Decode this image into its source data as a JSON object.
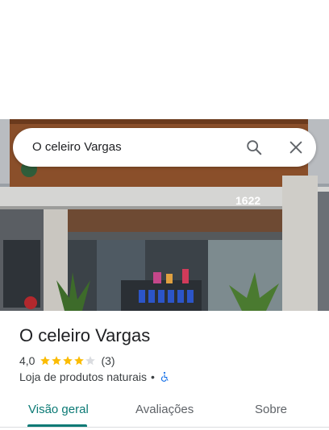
{
  "search": {
    "value": "O celeiro Vargas"
  },
  "place": {
    "name": "O celeiro Vargas",
    "rating": "4,0",
    "rating_stars": 4,
    "review_count": "(3)",
    "category": "Loja de produtos naturais",
    "separator": "•",
    "building_number": "1622"
  },
  "tabs": [
    {
      "label": "Visão geral",
      "active": true
    },
    {
      "label": "Avaliações",
      "active": false
    },
    {
      "label": "Sobre",
      "active": false
    }
  ],
  "colors": {
    "accent": "#0b7a75",
    "star": "#fbbc04",
    "star_empty": "#dadce0",
    "accessibility": "#1a73e8"
  }
}
